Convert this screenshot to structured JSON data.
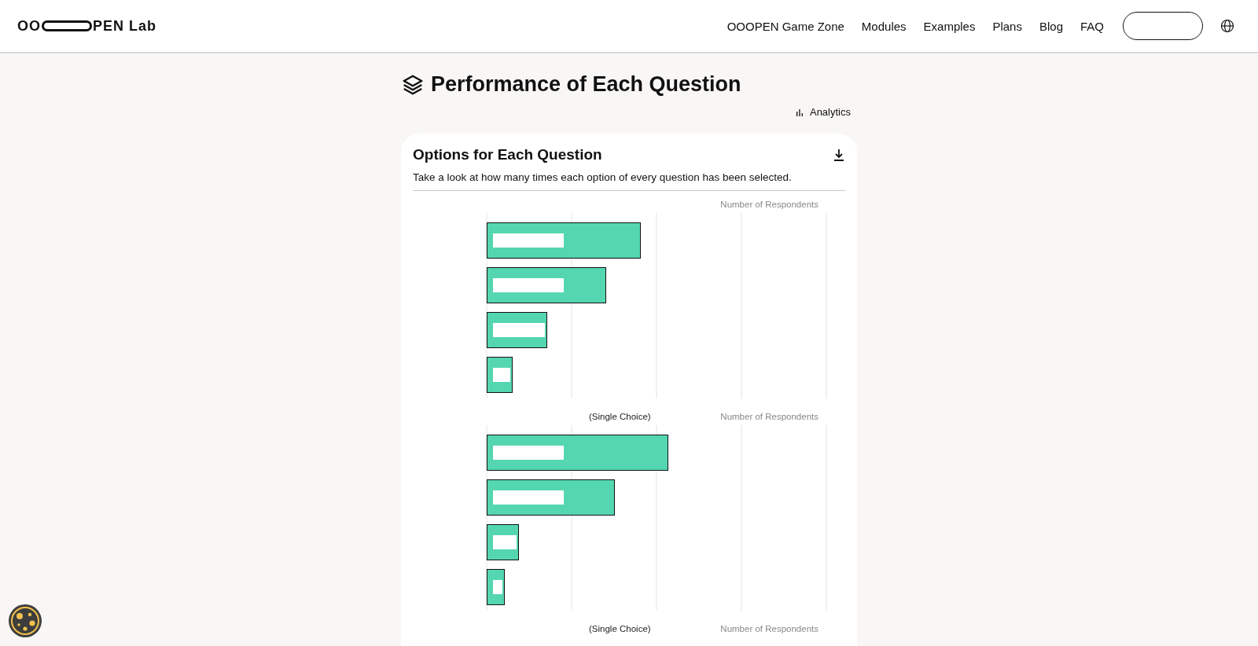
{
  "header": {
    "logo": {
      "before": "OO",
      "after": "PEN Lab"
    },
    "nav": [
      "OOOPEN Game Zone",
      "Modules",
      "Examples",
      "Plans",
      "Blog",
      "FAQ"
    ]
  },
  "page_title": "Performance of Each Question",
  "analytics_link": "Analytics",
  "card": {
    "title": "Options for Each Question",
    "description": "Take a look at how many times each option of every question has been selected.",
    "charts": [
      {
        "axis_label": "Number of Respondents"
      },
      {
        "subtitle": "(Single Choice)",
        "axis_label": "Number of Respondents"
      },
      {
        "subtitle": "(Single Choice)",
        "axis_label": "Number of Respondents"
      }
    ]
  }
}
